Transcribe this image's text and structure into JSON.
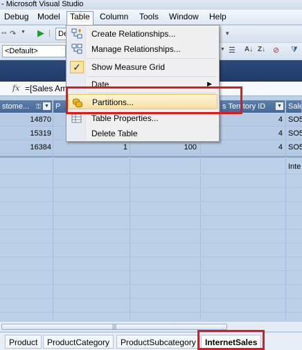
{
  "window": {
    "title": "- Microsoft Visual Studio"
  },
  "menubar": {
    "items": [
      "Debug",
      "Model",
      "Table",
      "Column",
      "Tools",
      "Window",
      "Help"
    ]
  },
  "toolbar": {
    "config_combo": "De",
    "perspective_combo": "<Default>"
  },
  "formula_bar": {
    "fx_label": "fx",
    "formula": "=[Sales Am"
  },
  "table_menu": {
    "items": [
      {
        "label": "Create Relationships...",
        "icon": "create-relationships-icon"
      },
      {
        "label": "Manage Relationships...",
        "icon": "manage-relationships-icon"
      },
      {
        "label": "Show Measure Grid",
        "icon": "checkmark-icon",
        "checked": true
      },
      {
        "label": "Date",
        "icon": "",
        "submenu": true
      },
      {
        "label": "Partitions...",
        "icon": "partitions-icon",
        "highlighted": true
      },
      {
        "label": "Table Properties...",
        "icon": "table-properties-icon"
      },
      {
        "label": "Delete Table",
        "icon": ""
      }
    ]
  },
  "grid": {
    "columns": [
      "stome...",
      "P",
      "",
      "s Territory ID",
      "Sale"
    ],
    "rows": [
      [
        "14870",
        "",
        "",
        "4",
        "SO5"
      ],
      [
        "15319",
        "",
        "",
        "4",
        "SO5"
      ],
      [
        "16384",
        "1",
        "100",
        "4",
        "SO5"
      ]
    ],
    "measure_cell": "Inte"
  },
  "sheet_tabs": {
    "items": [
      "Product",
      "ProductCategory",
      "ProductSubcategory",
      "InternetSales"
    ],
    "active": "InternetSales"
  },
  "colors": {
    "highlight_red": "#e01a1a",
    "header_blue": "#47699a",
    "grid_blue": "#bcd1e8"
  }
}
